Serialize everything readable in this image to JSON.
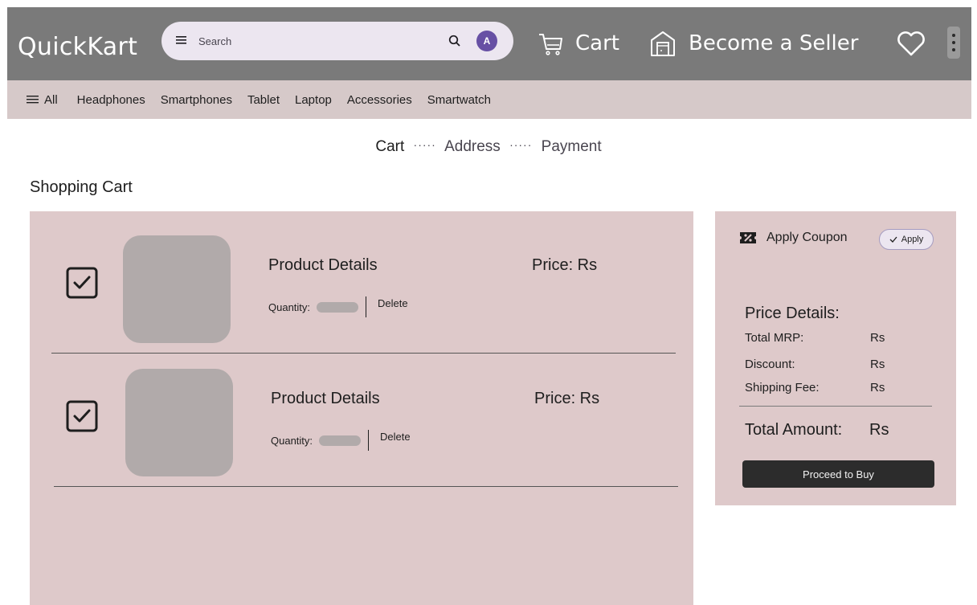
{
  "header": {
    "logo": "QuickKart",
    "search": {
      "placeholder": "Search",
      "avatar_initial": "A"
    },
    "cart_label": "Cart",
    "seller_label": "Become a Seller"
  },
  "categories": {
    "all_label": "All",
    "items": [
      "Headphones",
      "Smartphones",
      "Tablet",
      "Laptop",
      "Accessories",
      "Smartwatch"
    ]
  },
  "stepper": {
    "steps": [
      "Cart",
      "Address",
      "Payment"
    ],
    "active": "Cart",
    "separator": "·····"
  },
  "page_title": "Shopping Cart",
  "cart_items": [
    {
      "checked": true,
      "title": "Product Details",
      "price": "Price: Rs",
      "quantity_label": "Quantity:",
      "delete_label": "Delete"
    },
    {
      "checked": true,
      "title": "Product Details",
      "price": "Price: Rs",
      "quantity_label": "Quantity:",
      "delete_label": "Delete"
    }
  ],
  "summary": {
    "coupon_label": "Apply Coupon",
    "apply_label": "Apply",
    "price_details_title": "Price Details:",
    "rows": [
      {
        "label": "Total MRP:",
        "value": "Rs"
      },
      {
        "label": "Discount:",
        "value": "Rs"
      },
      {
        "label": "Shipping Fee:",
        "value": "Rs"
      }
    ],
    "total_label": "Total Amount:",
    "total_value": "Rs",
    "buy_label": "Proceed to Buy"
  },
  "colors": {
    "header_bg": "#7a7a7a",
    "category_bar_bg": "#d6c9c9",
    "panel_bg": "#dec9ca",
    "search_bg": "#ece6f0",
    "avatar": "#6750a4",
    "buy_button": "#2c2c2c"
  },
  "icons": [
    "menu-icon",
    "search-icon",
    "cart-icon",
    "store-icon",
    "heart-icon",
    "more-vertical-icon",
    "checkbox-checked-icon",
    "coupon-icon",
    "check-icon"
  ]
}
